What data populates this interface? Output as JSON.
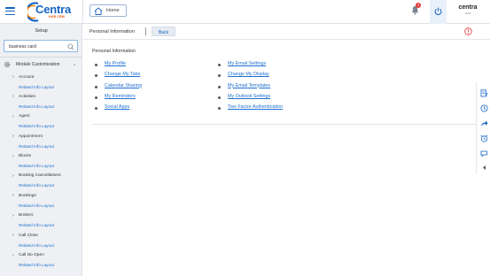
{
  "topbar": {
    "logo_text": "Centra",
    "logo_sub": "HUB CRM",
    "home_label": "Home",
    "notification_count": "3",
    "brand_mini_title": "centra",
    "brand_mini_sub": "HUB",
    "accent": "#1565c0"
  },
  "sidebar": {
    "title": "Setup",
    "search_value": "business card",
    "module_label": "Module Customization",
    "items": [
      {
        "label": "Account",
        "link": "Related Info Layout"
      },
      {
        "label": "Activities",
        "link": "Related Info Layout"
      },
      {
        "label": "Agent",
        "link": "Related Info Layout"
      },
      {
        "label": "Appointment",
        "link": "Related Info Layout"
      },
      {
        "label": "Blocks",
        "link": "Related Info Layout"
      },
      {
        "label": "Booking Cancellations",
        "link": "Related Info Layout"
      },
      {
        "label": "Bookings",
        "link": "Related Info Layout"
      },
      {
        "label": "Brokers",
        "link": "Related Info Layout"
      },
      {
        "label": "Call Close",
        "link": "Related Info Layout"
      },
      {
        "label": "Call No Open",
        "link": "Related Info Layout"
      }
    ]
  },
  "main": {
    "page_title": "Personal Information",
    "back_label": "Back",
    "section_title": "Personal Information",
    "col1": [
      "My Profile",
      "Change My Tabs",
      "Calendar Sharing",
      "My Reminders",
      "Social Apps"
    ],
    "col2": [
      "My Email Settings",
      "Change My Display",
      "My Email Templates",
      "My Outlook Settings",
      "Two Factor Authentication"
    ]
  }
}
